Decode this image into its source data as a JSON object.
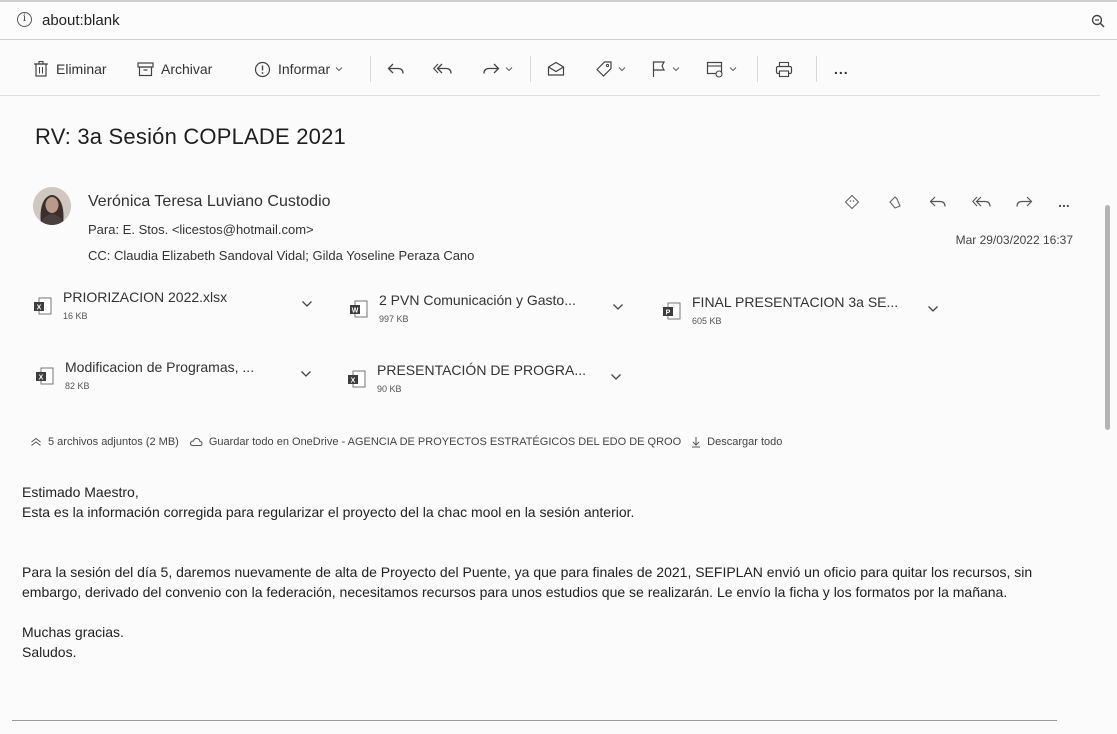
{
  "browser": {
    "url": "about:blank"
  },
  "toolbar": {
    "delete_label": "Eliminar",
    "archive_label": "Archivar",
    "report_label": "Informar",
    "more_label": "..."
  },
  "email": {
    "subject": "RV: 3a Sesión COPLADE 2021",
    "sender": "Verónica Teresa Luviano Custodio",
    "to": "Para:  E. Stos. <licestos@hotmail.com>",
    "cc": "CC:  Claudia Elizabeth Sandoval Vidal;  Gilda Yoseline Peraza Cano",
    "date": "Mar 29/03/2022 16:37",
    "more_label": "..."
  },
  "attachments": [
    {
      "name": "PRIORIZACION 2022.xlsx",
      "size": "16 KB",
      "type": "excel"
    },
    {
      "name": "2 PVN Comunicación y Gasto...",
      "size": "997 KB",
      "type": "word"
    },
    {
      "name": "FINAL PRESENTACION 3a SE...",
      "size": "605 KB",
      "type": "powerpoint"
    },
    {
      "name": "Modificacion de Programas, ...",
      "size": "82 KB",
      "type": "excel"
    },
    {
      "name": "PRESENTACIÓN DE PROGRA...",
      "size": "90 KB",
      "type": "excel"
    }
  ],
  "attachments_summary": {
    "count_label": "5 archivos adjuntos (2 MB)",
    "save_label": "Guardar todo en OneDrive - AGENCIA DE PROYECTOS ESTRATÉGICOS DEL EDO DE QROO",
    "download_label": "Descargar todo"
  },
  "body": {
    "greeting": "Estimado Maestro,",
    "line1": "Esta es la información corregida para regularizar el proyecto del la chac mool en la sesión anterior.",
    "paragraph2": "Para la sesión del día 5, daremos nuevamente de alta de Proyecto del Puente, ya que para finales de 2021, SEFIPLAN envió un oficio para quitar los recursos, sin embargo, derivado del convenio con la federación, necesitamos recursos para unos estudios que se realizarán. Le envío la ficha y los formatos por la mañana.",
    "closing1": "Muchas gracias.",
    "closing2": "Saludos."
  }
}
